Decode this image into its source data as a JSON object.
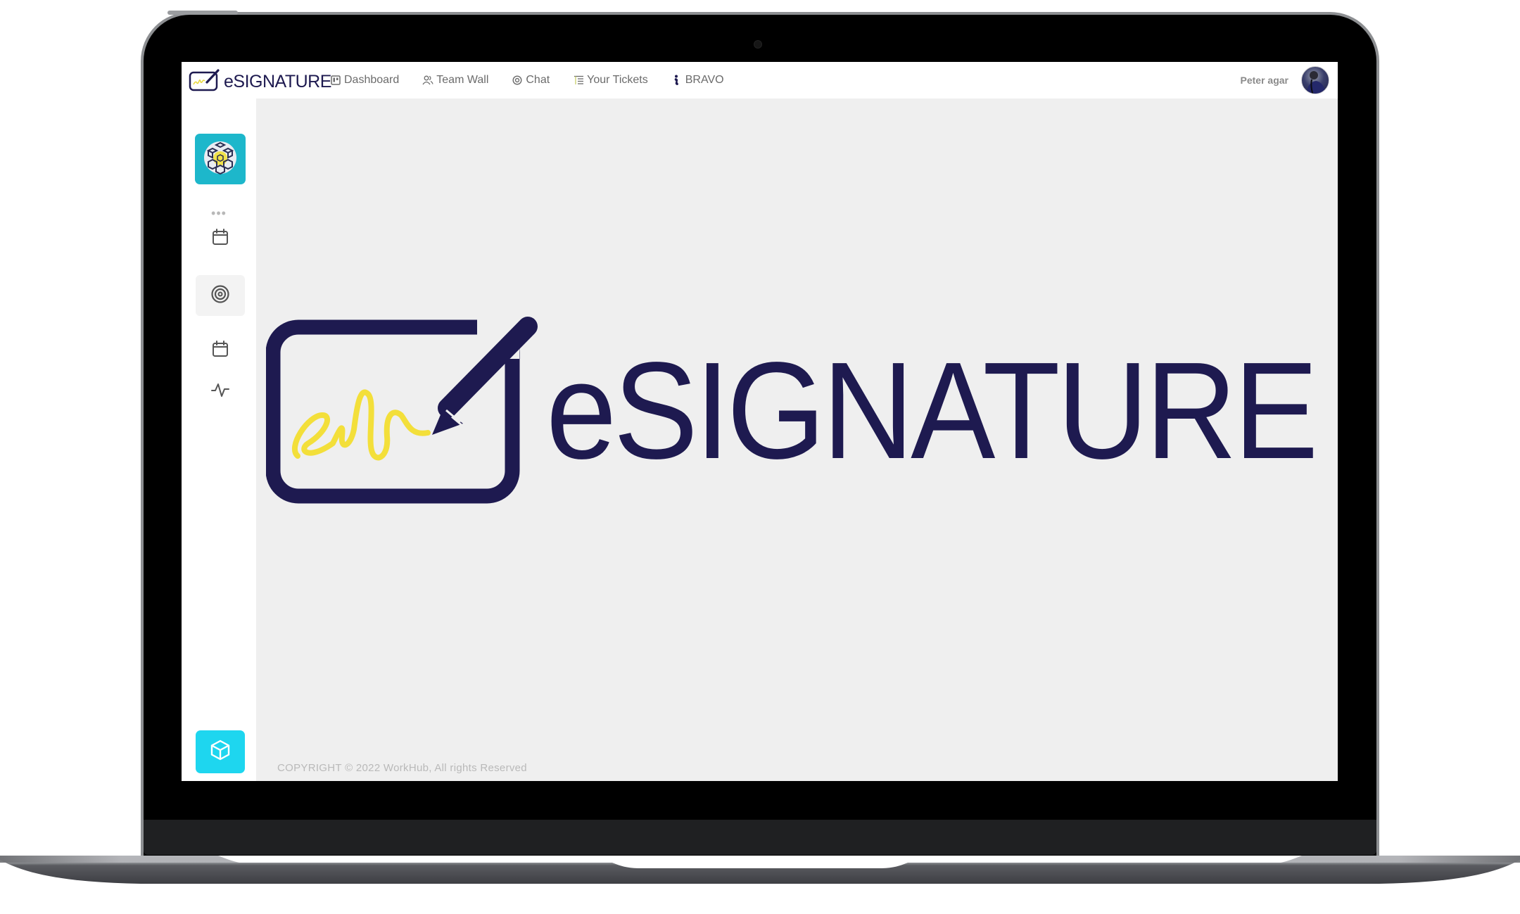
{
  "app": {
    "brand_name": "eSIGNATURE"
  },
  "header": {
    "nav": [
      {
        "label": "Dashboard",
        "icon": "dashboard-board-icon"
      },
      {
        "label": "Team Wall",
        "icon": "users-icon"
      },
      {
        "label": "Chat",
        "icon": "chat-at-icon"
      },
      {
        "label": "Your Tickets",
        "icon": "ticket-list-icon"
      },
      {
        "label": "BRAVO",
        "icon": "bravo-figure-icon"
      }
    ],
    "user": {
      "name": "Peter agar"
    }
  },
  "sidebar": {
    "top_tile_icon": "cube-grid-logo-icon",
    "more_label": "•••",
    "items": [
      {
        "icon": "calendar-icon",
        "active": false
      },
      {
        "icon": "target-icon",
        "active": true
      },
      {
        "icon": "calendar-icon",
        "active": false
      },
      {
        "icon": "activity-icon",
        "active": false
      }
    ],
    "bottom_button_icon": "cube-icon"
  },
  "main": {
    "hero_title": "eSIGNATURE",
    "copyright": "COPYRIGHT © 2022 WorkHub, All rights Reserved"
  },
  "colors": {
    "brand_navy": "#1e1a50",
    "signature_yellow": "#f3df3a",
    "sidebar_tile_teal": "#1db7cb",
    "sidebar_button_cyan": "#1ed6ef",
    "content_background": "#efefef"
  }
}
